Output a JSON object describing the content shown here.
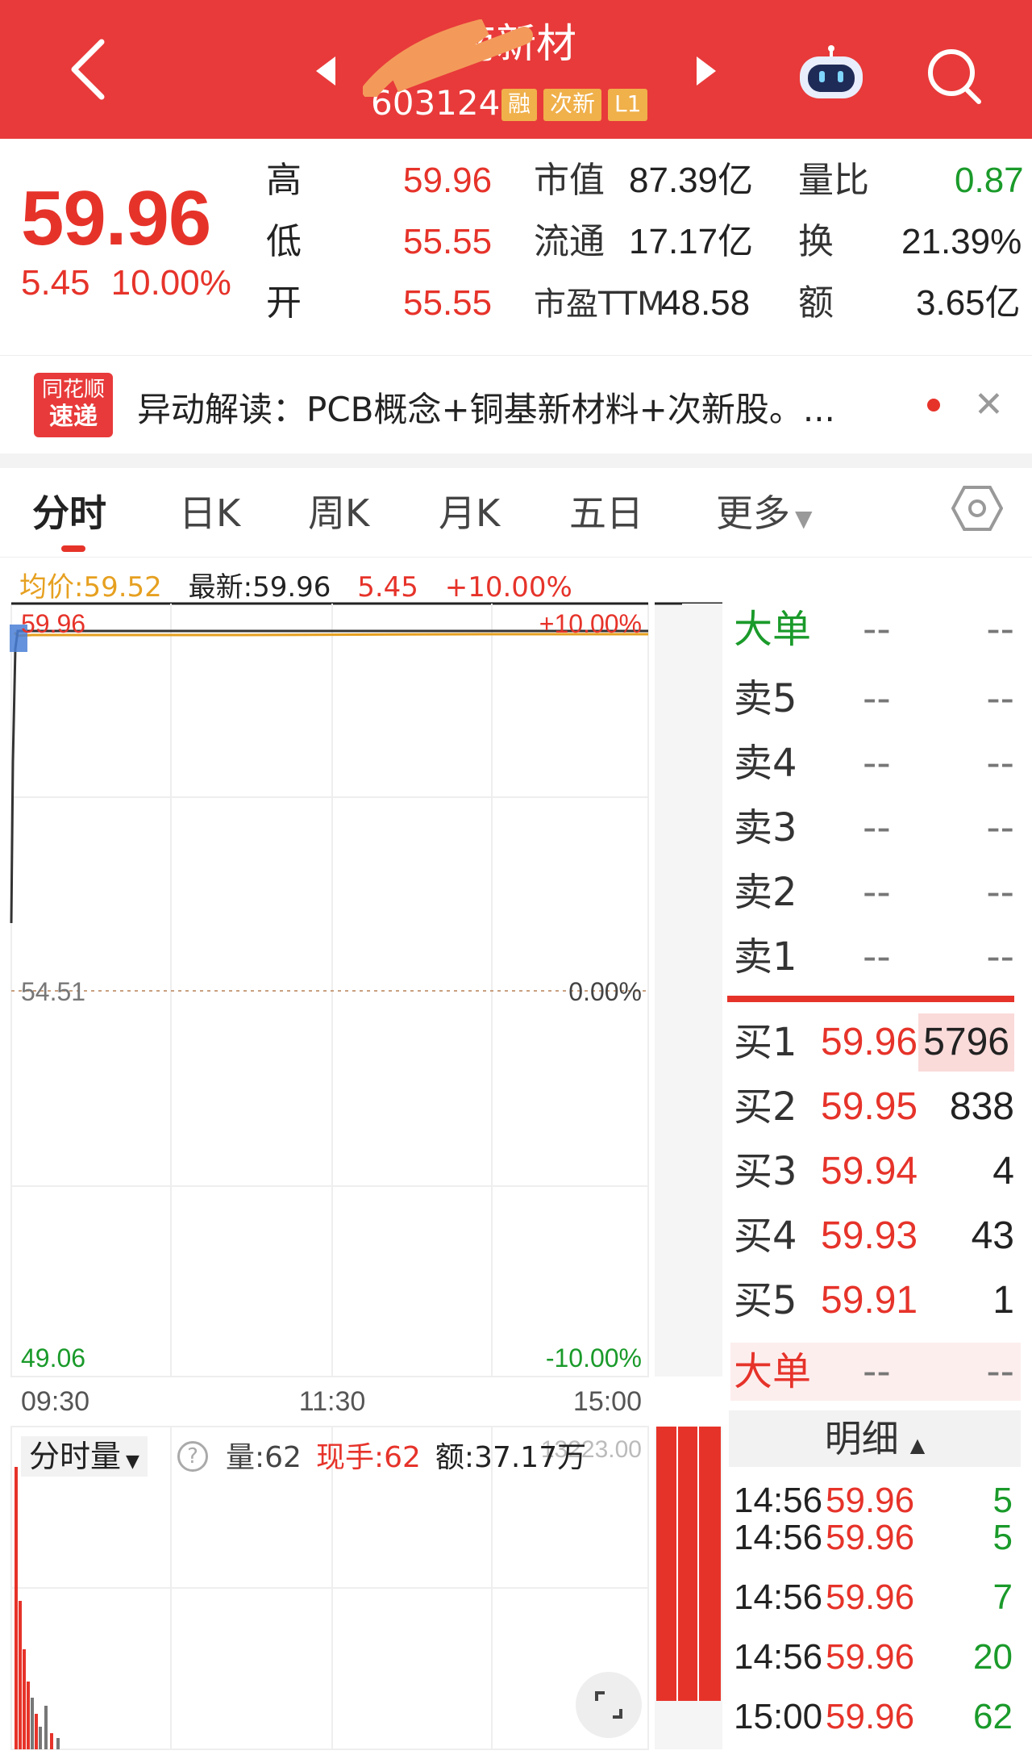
{
  "header": {
    "title": "南新材",
    "code": "603124",
    "tags": [
      "融",
      "次新",
      "L1"
    ]
  },
  "quote": {
    "price": "59.96",
    "change": "5.45",
    "change_pct": "10.00%",
    "rows": [
      {
        "label": "高",
        "value": "59.96",
        "m_label": "市值",
        "m_value": "87.39亿",
        "r_label": "量比",
        "r_value": "0.87"
      },
      {
        "label": "低",
        "value": "55.55",
        "m_label": "流通",
        "m_value": "17.17亿",
        "r_label": "换",
        "r_value": "21.39%"
      },
      {
        "label": "开",
        "value": "55.55",
        "m_label": "市盈TTM",
        "m_value": "48.58",
        "r_label": "额",
        "r_value": "3.65亿"
      }
    ]
  },
  "news": {
    "logo_line1": "同花顺",
    "logo_line2": "速递",
    "text": "异动解读：PCB概念+铜基新材料+次新股。..."
  },
  "tabs": [
    "分时",
    "日K",
    "周K",
    "月K",
    "五日",
    "更多"
  ],
  "info": {
    "avg": "均价:59.52",
    "latest": "最新:59.96",
    "change": "5.45",
    "pct": "+10.00%"
  },
  "chart_data": {
    "type": "line",
    "y_top": "59.96",
    "y_mid": "54.51",
    "y_bottom": "49.06",
    "pct_top": "+10.00%",
    "pct_mid": "0.00%",
    "pct_bottom": "-10.00%",
    "x_labels": [
      "09:30",
      "11:30",
      "15:00"
    ],
    "ylim": [
      49.06,
      59.96
    ],
    "colors": {
      "price": "#333333",
      "avg": "#e6a020",
      "base": "#c8a080"
    }
  },
  "volume": {
    "label": "分时量",
    "vol": "量:62",
    "now": "现手:62",
    "amt": "额:37.17万",
    "max": "13223.00"
  },
  "orderbook": {
    "big_top": {
      "label": "大单",
      "a": "--",
      "b": "--"
    },
    "sells": [
      {
        "label": "卖5",
        "a": "--",
        "b": "--"
      },
      {
        "label": "卖4",
        "a": "--",
        "b": "--"
      },
      {
        "label": "卖3",
        "a": "--",
        "b": "--"
      },
      {
        "label": "卖2",
        "a": "--",
        "b": "--"
      },
      {
        "label": "卖1",
        "a": "--",
        "b": "--"
      }
    ],
    "buys": [
      {
        "label": "买1",
        "price": "59.96",
        "vol": "5796"
      },
      {
        "label": "买2",
        "price": "59.95",
        "vol": "838"
      },
      {
        "label": "买3",
        "price": "59.94",
        "vol": "4"
      },
      {
        "label": "买4",
        "price": "59.93",
        "vol": "43"
      },
      {
        "label": "买5",
        "price": "59.91",
        "vol": "1"
      }
    ],
    "big_bottom": {
      "label": "大单",
      "a": "--",
      "b": "--"
    },
    "detail_label": "明细",
    "ticks": [
      {
        "t": "14:56",
        "p": "59.96",
        "v": "5"
      },
      {
        "t": "14:56",
        "p": "59.96",
        "v": "5"
      },
      {
        "t": "14:56",
        "p": "59.96",
        "v": "7"
      },
      {
        "t": "14:56",
        "p": "59.96",
        "v": "20"
      },
      {
        "t": "15:00",
        "p": "59.96",
        "v": "62"
      }
    ]
  }
}
